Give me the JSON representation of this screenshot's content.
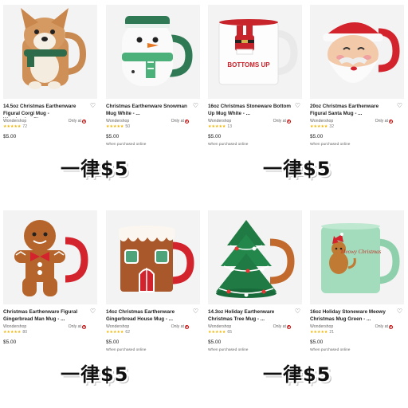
{
  "products": [
    {
      "title": "14.5oz Christmas Earthenware Figural Corgi Mug - Wondershop™",
      "brand": "Wondershop",
      "availability": "Only at",
      "stars": "★★★★★",
      "review_count": "72",
      "price": "$5.00",
      "note": ""
    },
    {
      "title": "Christmas Earthenware Snowman Mug White - ...",
      "brand": "Wondershop",
      "availability": "Only at",
      "stars": "★★★★★",
      "review_count": "50",
      "price": "$5.00",
      "note": "When purchased online"
    },
    {
      "title": "16oz Christmas Stoneware Bottom Up Mug White - ...",
      "brand": "Wondershop",
      "availability": "Only at",
      "stars": "★★★★★",
      "review_count": "13",
      "price": "$5.00",
      "note": "When purchased online"
    },
    {
      "title": "20oz Christmas Earthenware Figural Santa Mug - ...",
      "brand": "Wondershop",
      "availability": "Only at",
      "stars": "★★★★★",
      "review_count": "32",
      "price": "$5.00",
      "note": "When purchased online"
    },
    {
      "title": "Christmas Earthenware Figural Gingerbread Man Mug - ...",
      "brand": "Wondershop",
      "availability": "Only at",
      "stars": "★★★★★",
      "review_count": "80",
      "price": "$5.00",
      "note": ""
    },
    {
      "title": "14oz Christmas Earthenware Gingerbread House Mug - ...",
      "brand": "Wondershop",
      "availability": "Only at",
      "stars": "★★★★★",
      "review_count": "62",
      "price": "$5.00",
      "note": "When purchased online"
    },
    {
      "title": "14.3oz Holiday Earthenware Christmas Tree Mug - ...",
      "brand": "Wondershop",
      "availability": "Only at",
      "stars": "★★★★★",
      "review_count": "65",
      "price": "$5.00",
      "note": "When purchased online"
    },
    {
      "title": "16oz Holiday Stoneware Meowy Christmas Mug Green - ...",
      "brand": "Wondershop",
      "availability": "Only at",
      "stars": "★★★★★",
      "review_count": "21",
      "price": "$5.00",
      "note": "When purchased online"
    }
  ],
  "promo_text": "一律$5",
  "mug_texts": {
    "bottoms_up": "BOTTOMS UP",
    "meowy": "Meowy Christmas"
  },
  "icons": {
    "favorite": "heart-outline-icon",
    "retailer": "target-bullseye-icon"
  },
  "colors": {
    "rating_star": "#f0b400",
    "retailer_red": "#cc0000",
    "tile_bg": "#f3f3f3"
  }
}
